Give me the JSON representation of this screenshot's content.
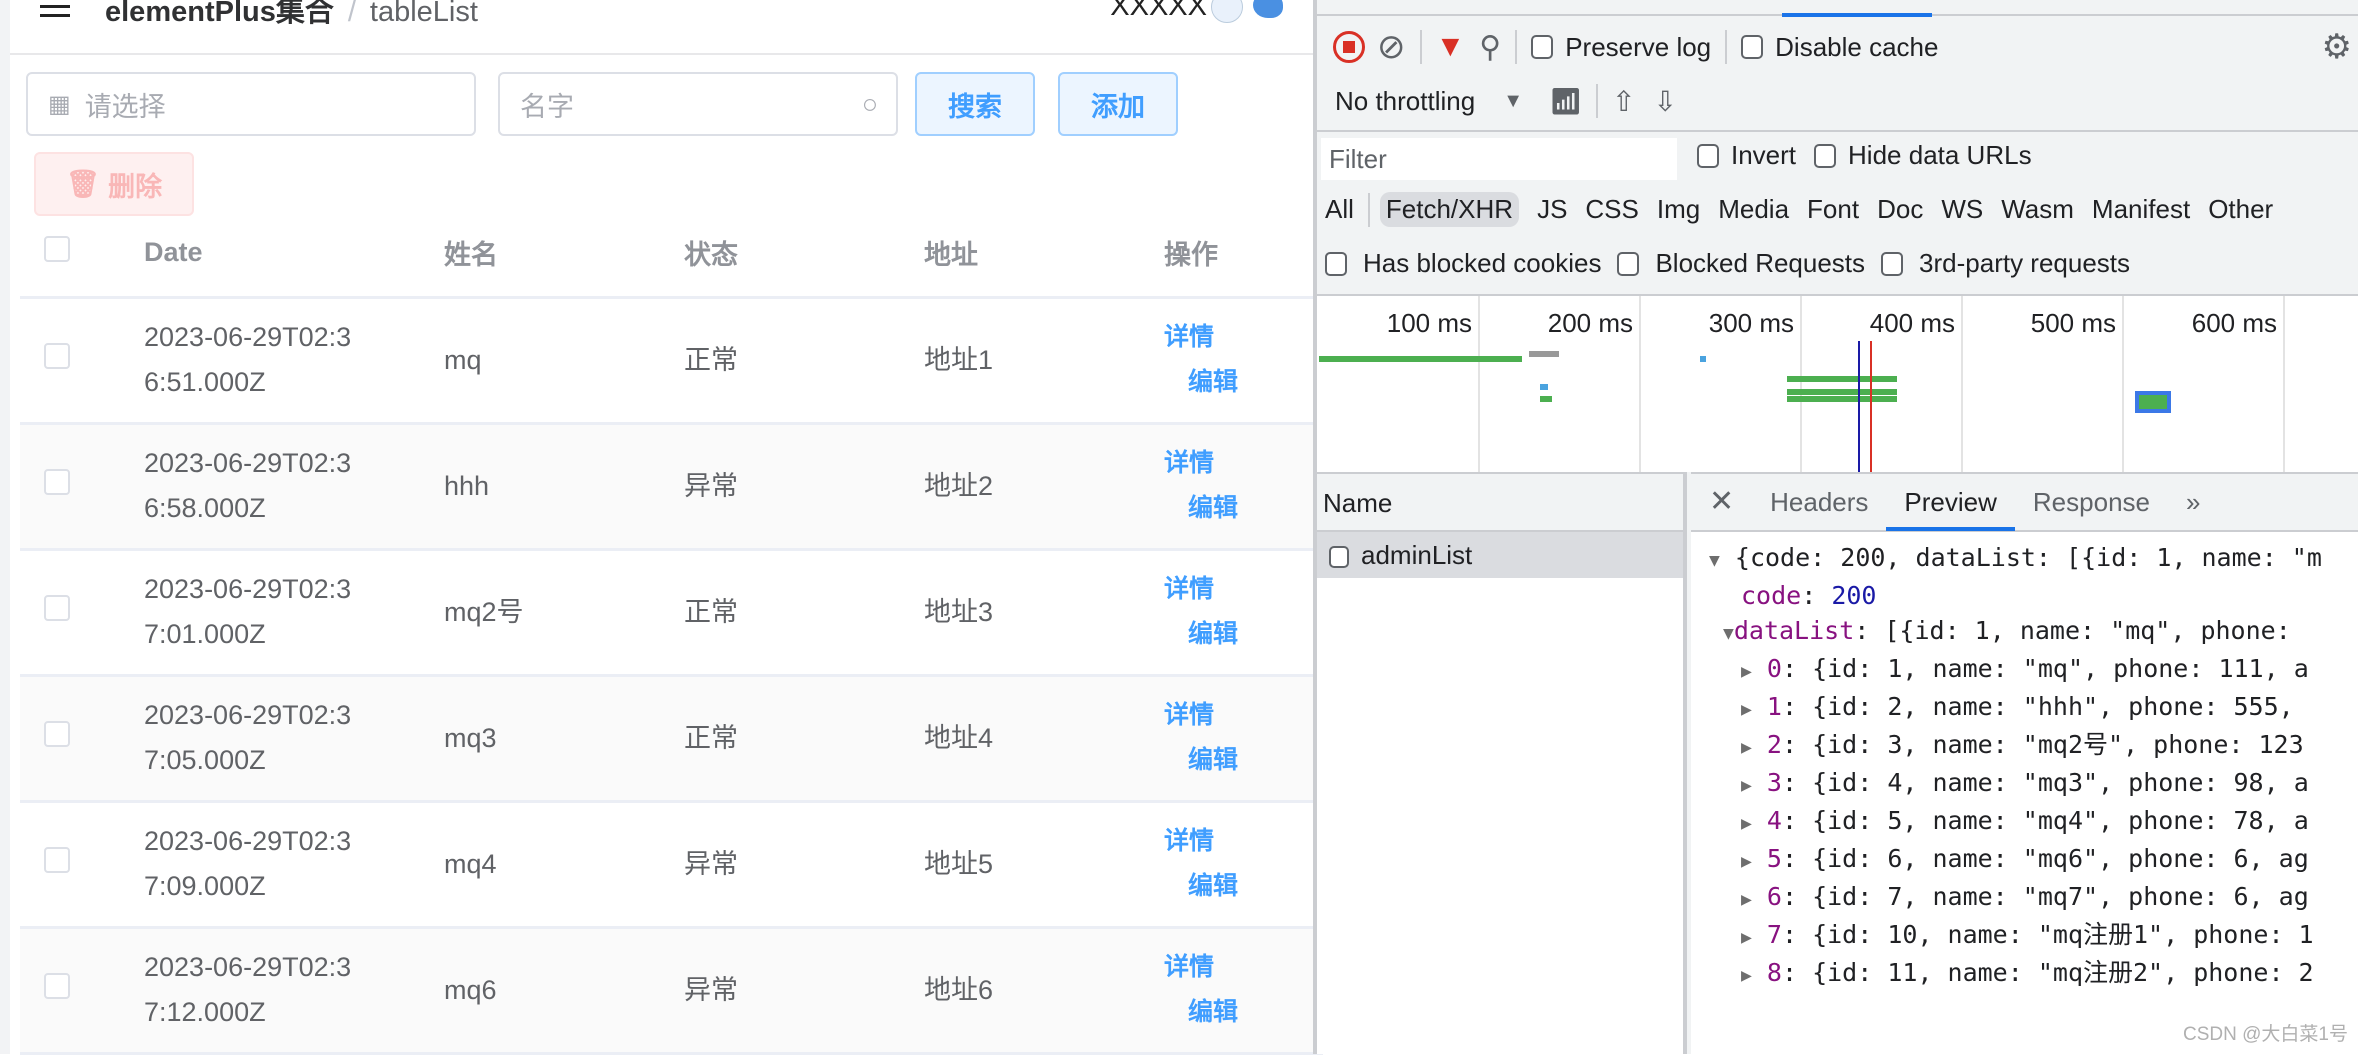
{
  "app": {
    "breadcrumb": {
      "root": "elementPlus集合",
      "current": "tableList"
    },
    "user": "XXXXX"
  },
  "toolbar": {
    "date_placeholder": "请选择",
    "name_placeholder": "名字",
    "search_label": "搜索",
    "add_label": "添加",
    "delete_label": "删除"
  },
  "table": {
    "columns": [
      "Date",
      "姓名",
      "状态",
      "地址",
      "操作"
    ],
    "rows": [
      {
        "date1": "2023-06-29T02:3",
        "date2": "6:51.000Z",
        "name": "mq",
        "status": "正常",
        "addr": "地址1"
      },
      {
        "date1": "2023-06-29T02:3",
        "date2": "6:58.000Z",
        "name": "hhh",
        "status": "异常",
        "addr": "地址2"
      },
      {
        "date1": "2023-06-29T02:3",
        "date2": "7:01.000Z",
        "name": "mq2号",
        "status": "正常",
        "addr": "地址3"
      },
      {
        "date1": "2023-06-29T02:3",
        "date2": "7:05.000Z",
        "name": "mq3",
        "status": "正常",
        "addr": "地址4"
      },
      {
        "date1": "2023-06-29T02:3",
        "date2": "7:09.000Z",
        "name": "mq4",
        "status": "异常",
        "addr": "地址5"
      },
      {
        "date1": "2023-06-29T02:3",
        "date2": "7:12.000Z",
        "name": "mq6",
        "status": "异常",
        "addr": "地址6"
      }
    ],
    "detail_label": "详情",
    "edit_label": "编辑"
  },
  "devtools": {
    "preserve_log": "Preserve log",
    "disable_cache": "Disable cache",
    "throttling": "No throttling",
    "filter_placeholder": "Filter",
    "invert": "Invert",
    "hide_data_urls": "Hide data URLs",
    "types": [
      "All",
      "Fetch/XHR",
      "JS",
      "CSS",
      "Img",
      "Media",
      "Font",
      "Doc",
      "WS",
      "Wasm",
      "Manifest",
      "Other"
    ],
    "has_blocked_cookies": "Has blocked cookies",
    "blocked_requests": "Blocked Requests",
    "third_party": "3rd-party requests",
    "ticks": [
      "100 ms",
      "200 ms",
      "300 ms",
      "400 ms",
      "500 ms",
      "600 ms"
    ],
    "name_header": "Name",
    "request": "adminList",
    "tabs": [
      "Headers",
      "Preview",
      "Response"
    ],
    "preview": {
      "summary": "{code: 200, dataList: [{id: 1, name: \"m",
      "code_key": "code",
      "code_val": "200",
      "datalist_key": "dataList",
      "datalist_val": ": [{id: 1, name: \"mq\", phone:",
      "items": [
        {
          "i": "0",
          "t": ": {id: 1, name: \"mq\", phone: 111, a"
        },
        {
          "i": "1",
          "t": ": {id: 2, name: \"hhh\", phone: 555,"
        },
        {
          "i": "2",
          "t": ": {id: 3, name: \"mq2号\", phone: 123"
        },
        {
          "i": "3",
          "t": ": {id: 4, name: \"mq3\", phone: 98, a"
        },
        {
          "i": "4",
          "t": ": {id: 5, name: \"mq4\", phone: 78, a"
        },
        {
          "i": "5",
          "t": ": {id: 6, name: \"mq6\", phone: 6, ag"
        },
        {
          "i": "6",
          "t": ": {id: 7, name: \"mq7\", phone: 6, ag"
        },
        {
          "i": "7",
          "t": ": {id: 10, name: \"mq注册1\", phone: 1"
        },
        {
          "i": "8",
          "t": ": {id: 11, name: \"mq注册2\", phone: 2"
        }
      ]
    },
    "watermark": "CSDN @大白菜1号"
  }
}
